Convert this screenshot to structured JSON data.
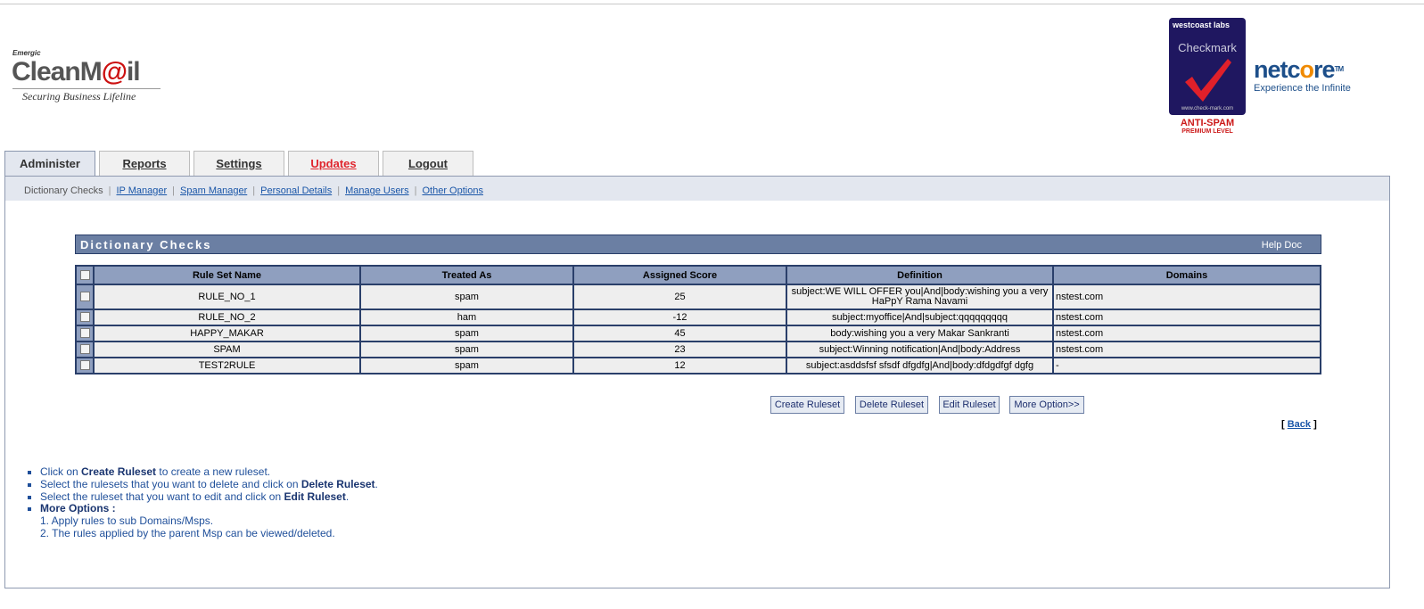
{
  "logo": {
    "small": "Emergic",
    "brand_a": "CleanM",
    "brand_b": "@",
    "brand_c": "il",
    "tagline": "Securing Business Lifeline"
  },
  "badge": {
    "top": "westcoast labs",
    "title": "Checkmark",
    "url": "www.check-mark.com",
    "antispam": "ANTI-SPAM",
    "level": "PREMIUM LEVEL"
  },
  "netcore": {
    "a": "netc",
    "o": "o",
    "b": "re",
    "tm": "TM",
    "tagline": "Experience the Infinite"
  },
  "tabs": [
    {
      "label": "Administer"
    },
    {
      "label": "Reports"
    },
    {
      "label": "Settings"
    },
    {
      "label": "Updates"
    },
    {
      "label": "Logout"
    }
  ],
  "subnav": {
    "current": "Dictionary Checks",
    "links": [
      "IP Manager",
      "Spam Manager",
      "Personal Details",
      "Manage Users",
      "Other Options"
    ]
  },
  "section": {
    "title": "Dictionary Checks",
    "help": "Help Doc"
  },
  "table": {
    "columns": [
      "Rule Set Name",
      "Treated As",
      "Assigned Score",
      "Definition",
      "Domains"
    ],
    "rows": [
      {
        "name": "RULE_NO_1",
        "treated": "spam",
        "score": "25",
        "definition": "subject:WE WILL OFFER you|And|body:wishing you a very HaPpY Rama Navami",
        "domains": "nstest.com"
      },
      {
        "name": "RULE_NO_2",
        "treated": "ham",
        "score": "-12",
        "definition": "subject:myoffice|And|subject:qqqqqqqqq",
        "domains": "nstest.com"
      },
      {
        "name": "HAPPY_MAKAR",
        "treated": "spam",
        "score": "45",
        "definition": "body:wishing you a very Makar Sankranti",
        "domains": "nstest.com"
      },
      {
        "name": "SPAM",
        "treated": "spam",
        "score": "23",
        "definition": "subject:Winning notification|And|body:Address",
        "domains": "nstest.com"
      },
      {
        "name": "TEST2RULE",
        "treated": "spam",
        "score": "12",
        "definition": "subject:asddsfsf sfsdf dfgdfg|And|body:dfdgdfgf dgfg",
        "domains": "-"
      }
    ]
  },
  "buttons": {
    "create": "Create Ruleset",
    "delete": "Delete Ruleset",
    "edit": "Edit Ruleset",
    "more": "More Option>>"
  },
  "back": {
    "open": "[ ",
    "label": "Back",
    "close": " ]"
  },
  "help": {
    "line1_a": "Click on ",
    "line1_b": "Create Ruleset",
    "line1_c": " to create a new ruleset.",
    "line2_a": "Select the rulesets that you want to delete and click on ",
    "line2_b": "Delete Ruleset",
    "line2_c": ".",
    "line3_a": "Select the ruleset that you want to edit and click on ",
    "line3_b": "Edit Ruleset",
    "line3_c": ".",
    "line4": "More Options :",
    "opt1": "1. Apply rules to sub Domains/Msps.",
    "opt2": "2. The rules applied by the parent Msp can be viewed/deleted."
  }
}
